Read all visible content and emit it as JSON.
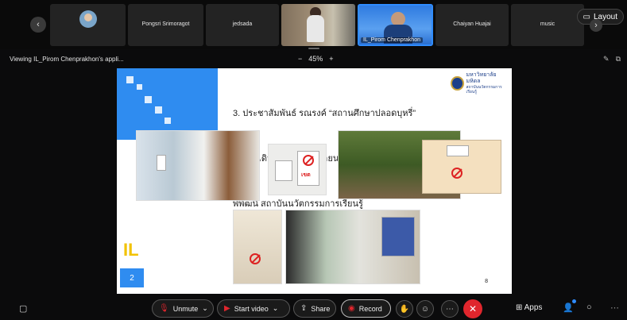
{
  "participants": [
    {
      "name": "",
      "kind": "avatar"
    },
    {
      "name": "Pongsri Srimoragot",
      "kind": "name"
    },
    {
      "name": "jedsada",
      "kind": "name"
    },
    {
      "name": "",
      "kind": "camera"
    },
    {
      "name": "IL_Pirom Chenprakhon",
      "kind": "camera-active"
    },
    {
      "name": "Chaiyan Huajai",
      "kind": "name"
    },
    {
      "name": "music",
      "kind": "name"
    }
  ],
  "layout_label": "Layout",
  "share": {
    "viewing_text": "Viewing IL_Pirom Chenprakhon's appli...",
    "zoom_minus": "−",
    "zoom_level": "45%",
    "zoom_plus": "+"
  },
  "slide": {
    "title_line1": "3. ประชาสัมพันธ์ รณรงค์ “สถานศึกษาปลอดบุหรี่”",
    "title_line2": "ณ ทางเดินภายใน และภายนอก อาคารปัญญา",
    "title_line3": "พิพัฒน์ สถาบันนวัตกรรมการเรียนรู้",
    "logo_line1": "มหาวิทยาลัยมหิดล",
    "logo_line2": "สถาบันนวัตกรรมการเรียนรู้",
    "sign_text_1": "เขต",
    "page_box": "2",
    "page_number": "8",
    "il_logo": "IL"
  },
  "toolbar": {
    "unmute": "Unmute",
    "start_video": "Start video",
    "share": "Share",
    "record": "Record",
    "apps": "Apps"
  },
  "colors": {
    "accent": "#2f8cf0",
    "end_call": "#e0262d",
    "active_border": "#2f8cff"
  }
}
